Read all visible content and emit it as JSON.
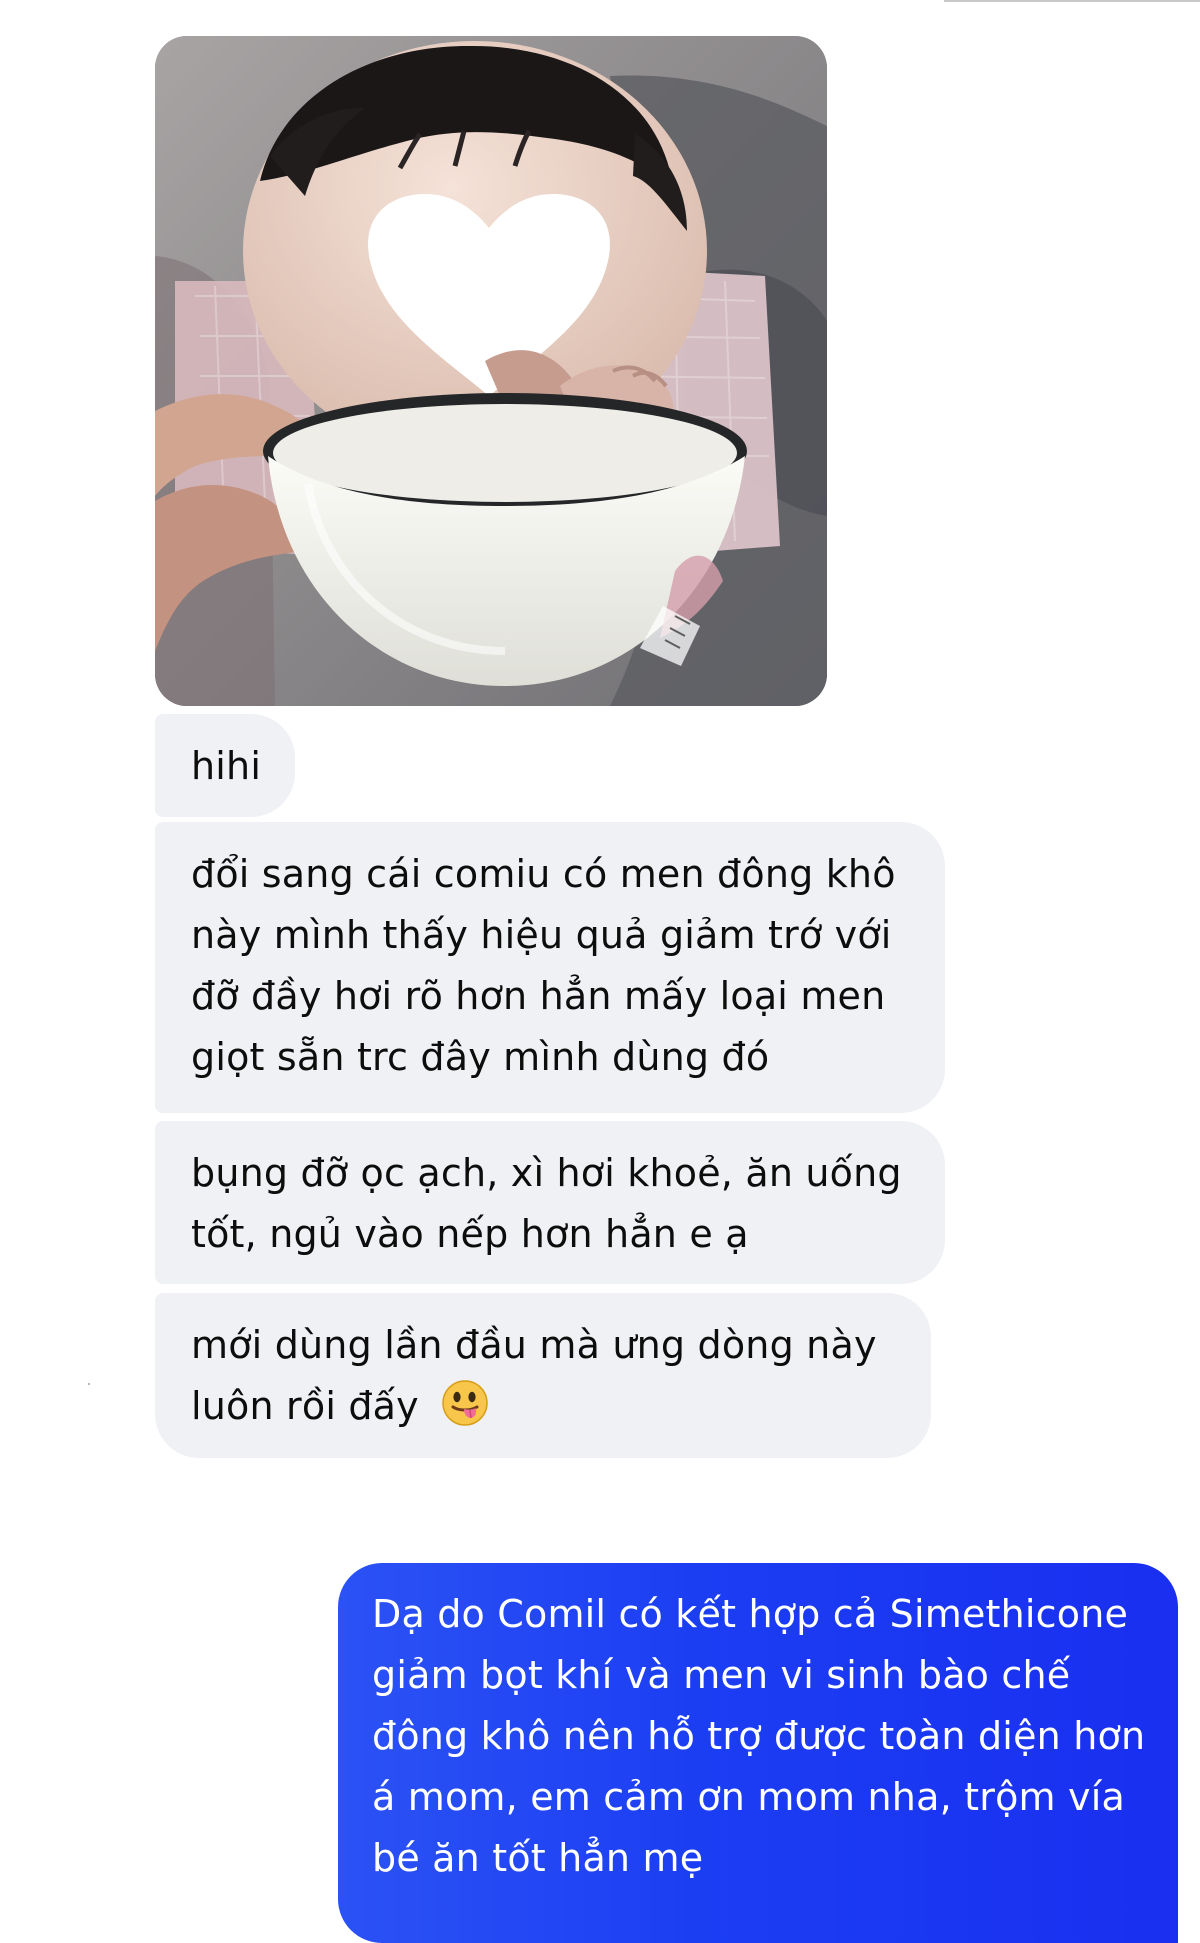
{
  "conversation": {
    "photo": {
      "emoji_overlay": "white-heart"
    },
    "incoming": [
      {
        "text": "hihi"
      },
      {
        "text": "đổi sang cái comiu có men đông khô này mình thấy hiệu quả giảm trớ với đỡ đầy hơi rõ hơn hẳn mấy loại men giọt sẵn trc đây mình dùng đó"
      },
      {
        "text": "bụng đỡ ọc ạch, xì hơi khoẻ, ăn uống tốt, ngủ vào nếp hơn hẳn e ạ"
      },
      {
        "text": "mới dùng lần đầu mà ưng dòng này luôn rồi đấy",
        "emoji": "tongue-emoji"
      }
    ],
    "outgoing": [
      {
        "text": "Dạ do Comil có kết hợp cả Simethicone giảm bọt khí và men vi sinh bào chế đông khô nên hỗ trợ được toàn diện hơn á mom, em cảm ơn mom nha, trộm vía bé ăn tốt hẳn mẹ"
      }
    ],
    "colors": {
      "incoming_bubble": "#f0f1f5",
      "outgoing_bubble": "#1f3ff2",
      "outgoing_text": "#ffffff"
    }
  }
}
